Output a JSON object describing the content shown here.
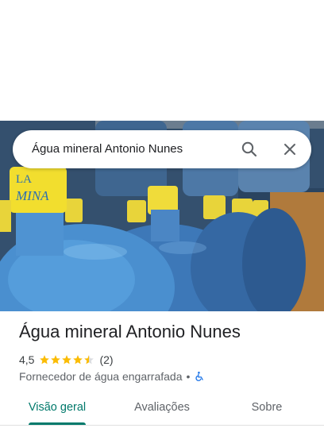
{
  "search": {
    "query": "Água mineral Antonio Nunes"
  },
  "hero": {
    "label_text": "LA MINA",
    "label_line1": "LA",
    "label_line2": "MINA"
  },
  "place": {
    "title": "Água mineral Antonio Nunes",
    "rating": "4,5",
    "stars": 4.5,
    "reviews": "(2)",
    "category": "Fornecedor de água engarrafada",
    "separator": "•"
  },
  "tabs": [
    {
      "label": "Visão geral",
      "active": true
    },
    {
      "label": "Avaliações",
      "active": false
    },
    {
      "label": "Sobre",
      "active": false
    }
  ],
  "colors": {
    "accent": "#00796b",
    "star": "#fbbc04",
    "accessibility": "#1a73e8"
  }
}
